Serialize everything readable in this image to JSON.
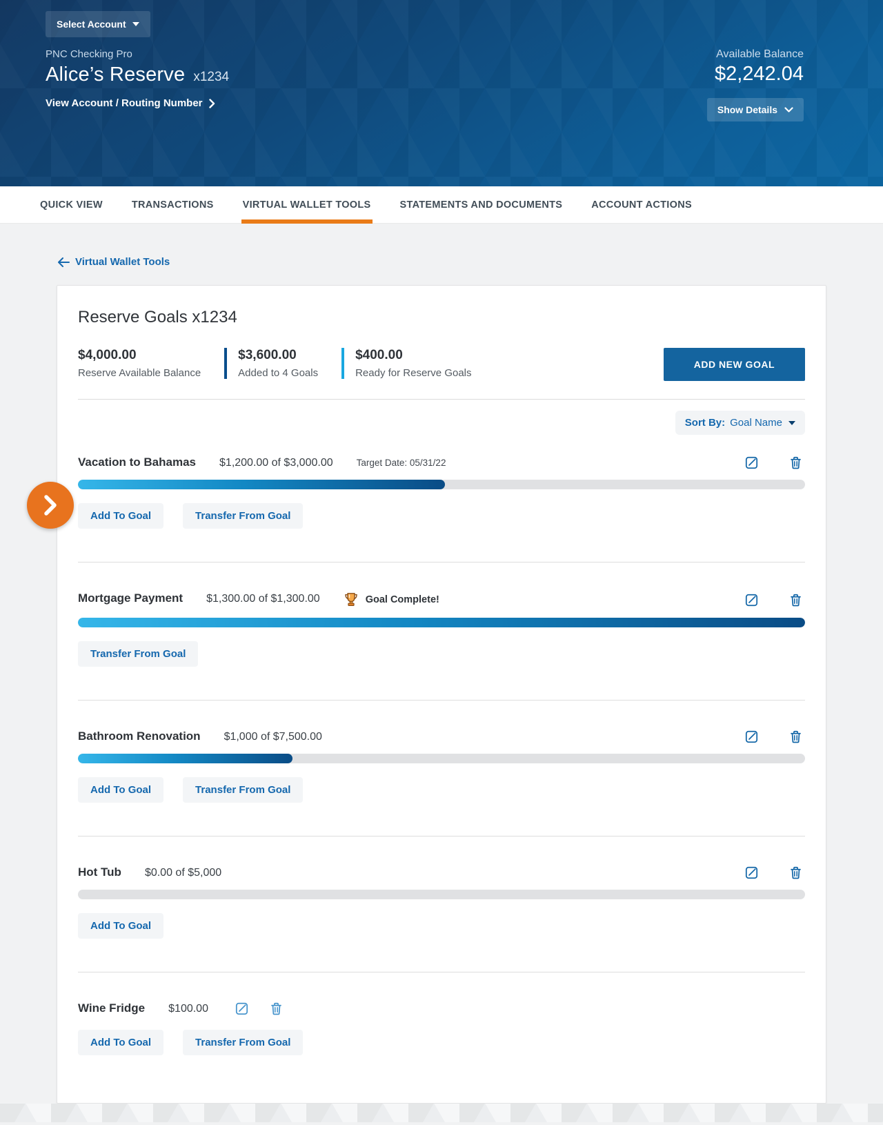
{
  "header": {
    "select_account_label": "Select Account",
    "account_type": "PNC Checking Pro",
    "account_name": "Alice’s Reserve",
    "account_number": "x1234",
    "view_account_link": "View Account / Routing Number",
    "available_balance_label": "Available Balance",
    "available_balance": "$2,242.04",
    "show_details_label": "Show Details"
  },
  "tabs": [
    {
      "label": "QUICK VIEW",
      "active": false
    },
    {
      "label": "TRANSACTIONS",
      "active": false
    },
    {
      "label": "VIRTUAL WALLET TOOLS",
      "active": true
    },
    {
      "label": "STATEMENTS AND DOCUMENTS",
      "active": false
    },
    {
      "label": "ACCOUNT ACTIONS",
      "active": false
    }
  ],
  "back_link_label": "Virtual Wallet Tools",
  "card": {
    "title": "Reserve Goals x1234",
    "stats": [
      {
        "value": "$4,000.00",
        "label": "Reserve Available Balance",
        "accent": ""
      },
      {
        "value": "$3,600.00",
        "label": "Added to 4 Goals",
        "accent": "#0a4e8c"
      },
      {
        "value": "$400.00",
        "label": "Ready for Reserve Goals",
        "accent": "#1aa7e0"
      }
    ],
    "add_goal_button": "ADD NEW GOAL",
    "sort": {
      "label": "Sort By:",
      "value": "Goal Name"
    },
    "action_labels": {
      "add": "Add To Goal",
      "transfer": "Transfer From Goal"
    },
    "goals": [
      {
        "name": "Vacation to Bahamas",
        "amount": "$1,200.00 of $3,000.00",
        "target_date": "Target Date: 05/31/22",
        "progress_pct": 50.5,
        "show_bar": true,
        "complete": false,
        "row_icons": true,
        "inline_icons": false,
        "actions": [
          "add",
          "transfer"
        ]
      },
      {
        "name": "Mortgage Payment",
        "amount": "$1,300.00 of $1,300.00",
        "complete_label": "Goal Complete!",
        "progress_pct": 100,
        "show_bar": true,
        "complete": true,
        "row_icons": true,
        "inline_icons": false,
        "actions": [
          "transfer"
        ]
      },
      {
        "name": "Bathroom Renovation",
        "amount": "$1,000 of $7,500.00",
        "progress_pct": 29.5,
        "show_bar": true,
        "complete": false,
        "row_icons": true,
        "inline_icons": false,
        "actions": [
          "add",
          "transfer"
        ]
      },
      {
        "name": "Hot Tub",
        "amount": "$0.00 of $5,000",
        "progress_pct": 0,
        "show_bar": true,
        "complete": false,
        "row_icons": true,
        "inline_icons": false,
        "actions": [
          "add"
        ]
      },
      {
        "name": "Wine Fridge",
        "amount": "$100.00",
        "progress_pct": null,
        "show_bar": false,
        "complete": false,
        "row_icons": false,
        "inline_icons": true,
        "actions": [
          "add",
          "transfer"
        ]
      }
    ]
  },
  "icons": {
    "select_account_caret": "caret-down",
    "sort_caret": "caret-down",
    "show_details_chevron": "chevron-down",
    "view_account_chevron": "chevron-right",
    "back_arrow": "arrow-left",
    "edit": "edit-pencil-square",
    "delete": "trash-can",
    "goal_complete": "trophy",
    "side_toggle": "chevron-right"
  },
  "colors": {
    "header_blue_top": "#143a64",
    "header_blue_bottom": "#0d68a4",
    "tab_underline_orange": "#e97b17",
    "link_blue": "#1568ae",
    "primary_button_blue": "#14649f",
    "progress_gradient_start": "#35b6e9",
    "progress_gradient_end": "#0a4c86",
    "stat_accent_dark_blue": "#0a4e8c",
    "stat_accent_cyan": "#1aa7e0",
    "side_toggle_orange": "#e8731e"
  }
}
